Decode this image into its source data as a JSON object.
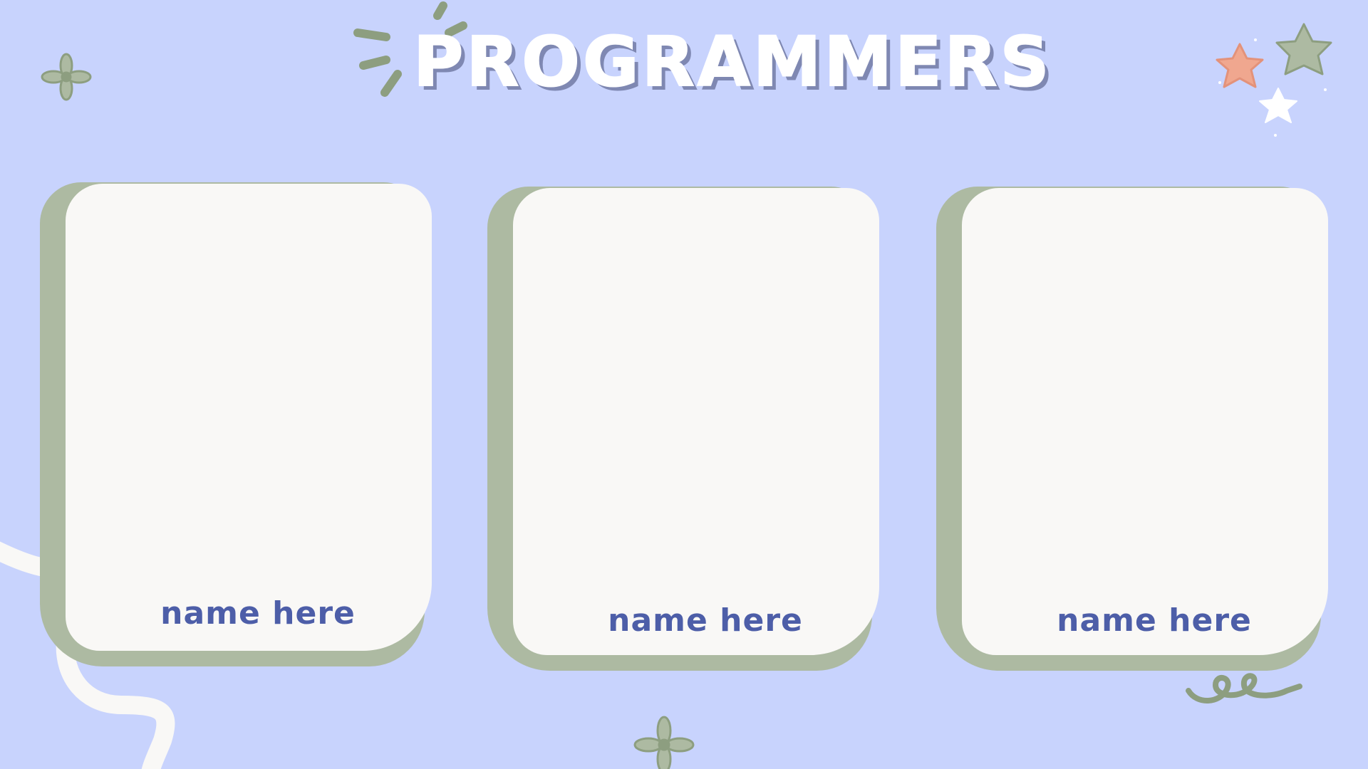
{
  "title": "PROGRAMMERS",
  "colors": {
    "background": "#c8d3fd",
    "card_face": "#f9f8f6",
    "card_shadow": "#adbaa2",
    "name_text": "#4d5ea8",
    "title_text": "#ffffff",
    "title_shadow": "#7f88b2",
    "accent_green": "#8d9e80",
    "accent_peach": "#f0a78f"
  },
  "cards": [
    {
      "name": "name here"
    },
    {
      "name": "name here"
    },
    {
      "name": "name here"
    }
  ],
  "decorations": {
    "title_sparkle": "sparkle-lines-icon",
    "top_left_flower": "flower-icon",
    "bottom_flower": "flower-icon",
    "stars": [
      "star-icon",
      "star-icon",
      "star-icon"
    ],
    "squiggle": "squiggle-icon",
    "ribbon": "wavy-ribbon"
  }
}
